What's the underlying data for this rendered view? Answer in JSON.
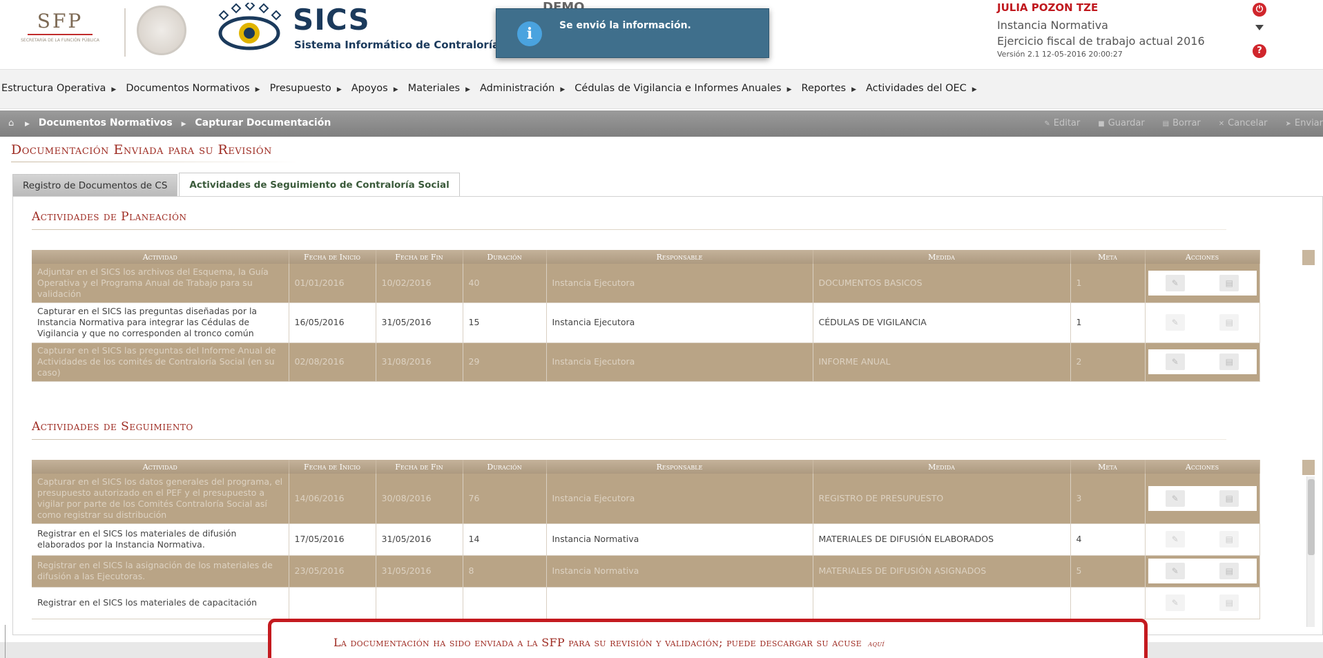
{
  "header": {
    "sfp_logo_text": "SFP",
    "sfp_logo_subtext": "SECRETARÍA DE LA FUNCIÓN PÚBLICA",
    "app_title": "SICS",
    "app_subtitle": "Sistema Informático de Contraloría Social",
    "demo_label": "DEMO",
    "notification": "Se envió la información.",
    "user": {
      "name": "JULIA POZON TZE",
      "role": "Instancia Normativa",
      "fiscal_year_label": "Ejercicio fiscal de trabajo actual",
      "fiscal_year": "2016",
      "version": "Versión 2.1   12-05-2016 20:00:27"
    }
  },
  "menu": [
    "Estructura Operativa",
    "Documentos Normativos",
    "Presupuesto",
    "Apoyos",
    "Materiales",
    "Administración",
    "Cédulas de Vigilancia e Informes Anuales",
    "Reportes",
    "Actividades del OEC"
  ],
  "breadcrumb": {
    "items": [
      "Documentos Normativos",
      "Capturar Documentación"
    ]
  },
  "toolbar": {
    "editar": "Editar",
    "guardar": "Guardar",
    "borrar": "Borrar",
    "cancelar": "Cancelar",
    "enviar": "Enviar"
  },
  "page_heading": "Documentación Enviada para su Revisión",
  "tabs": [
    {
      "label": "Registro de Documentos de CS",
      "active": false
    },
    {
      "label": "Actividades de Seguimiento de Contraloría Social",
      "active": true
    }
  ],
  "columns": {
    "actividad": "Actividad",
    "fecha_inicio": "Fecha de Inicio",
    "fecha_fin": "Fecha de Fin",
    "duracion": "Duración",
    "responsable": "Responsable",
    "medida": "Medida",
    "meta": "Meta",
    "acciones": "Acciones"
  },
  "planeacion": {
    "title": "Actividades de Planeación",
    "rows": [
      {
        "actividad": "Adjuntar en el SICS los archivos del Esquema, la Guía Operativa y el Programa Anual de Trabajo para su validación",
        "fecha_inicio": "01/01/2016",
        "fecha_fin": "10/02/2016",
        "duracion": "40",
        "responsable": "Instancia Ejecutora",
        "medida": "DOCUMENTOS BASICOS",
        "meta": "1"
      },
      {
        "actividad": "Capturar en el SICS las preguntas diseñadas por la Instancia Normativa para integrar las Cédulas de Vigilancia y que no corresponden al tronco común",
        "fecha_inicio": "16/05/2016",
        "fecha_fin": "31/05/2016",
        "duracion": "15",
        "responsable": "Instancia Ejecutora",
        "medida": "CÉDULAS DE VIGILANCIA",
        "meta": "1"
      },
      {
        "actividad": "Capturar en el SICS las preguntas del Informe Anual de Actividades de los comités de Contraloría Social (en su caso)",
        "fecha_inicio": "02/08/2016",
        "fecha_fin": "31/08/2016",
        "duracion": "29",
        "responsable": "Instancia Ejecutora",
        "medida": "INFORME ANUAL",
        "meta": "2"
      }
    ]
  },
  "seguimiento": {
    "title": "Actividades de Seguimiento",
    "rows": [
      {
        "actividad": "Capturar en el SICS los datos generales del programa, el presupuesto autorizado en el PEF y el presupuesto a vigilar por parte de los Comités Contraloría Social así como registrar su distribución",
        "fecha_inicio": "14/06/2016",
        "fecha_fin": "30/08/2016",
        "duracion": "76",
        "responsable": "Instancia Ejecutora",
        "medida": "REGISTRO DE PRESUPUESTO",
        "meta": "3"
      },
      {
        "actividad": "Registrar en el SICS los materiales de difusión elaborados por la Instancia Normativa.",
        "fecha_inicio": "17/05/2016",
        "fecha_fin": "31/05/2016",
        "duracion": "14",
        "responsable": "Instancia Normativa",
        "medida": "MATERIALES DE DIFUSIÓN ELABORADOS",
        "meta": "4"
      },
      {
        "actividad": "Registrar en el SICS la asignación de los materiales de difusión a las Ejecutoras.",
        "fecha_inicio": "23/05/2016",
        "fecha_fin": "31/05/2016",
        "duracion": "8",
        "responsable": "Instancia Normativa",
        "medida": "MATERIALES DE DIFUSIÓN ASIGNADOS",
        "meta": "5"
      },
      {
        "actividad": "Registrar en el SICS los materiales de capacitación",
        "fecha_inicio": "",
        "fecha_fin": "",
        "duracion": "",
        "responsable": "",
        "medida": "",
        "meta": ""
      }
    ]
  },
  "banner": {
    "text": "La documentación ha sido enviada a la SFP para su revisión y validación; puede descargar su acuse",
    "link": "aquí"
  }
}
